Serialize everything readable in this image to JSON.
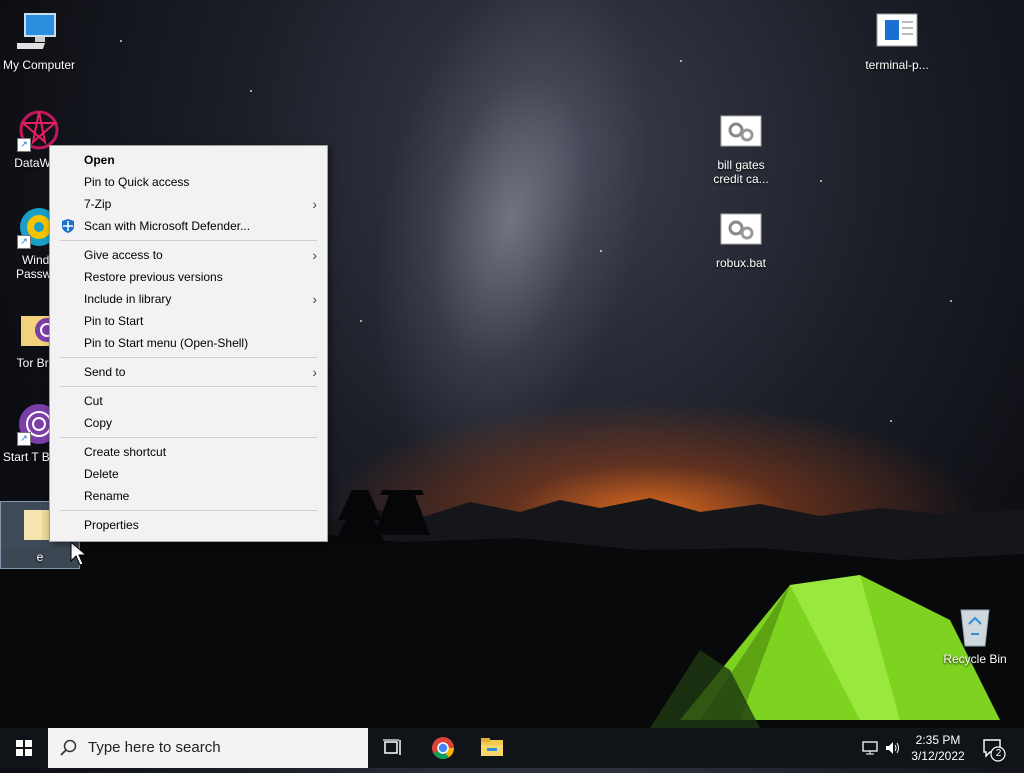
{
  "desktop": {
    "icons": [
      {
        "label": "My Computer"
      },
      {
        "label": "DataWag"
      },
      {
        "label": "Windo Passwor"
      },
      {
        "label": "Tor Brov"
      },
      {
        "label": "Start T Brows"
      },
      {
        "label": "e"
      },
      {
        "label": "terminal-p..."
      },
      {
        "label": "bill gates credit ca..."
      },
      {
        "label": "robux.bat"
      },
      {
        "label": "Recycle Bin"
      }
    ]
  },
  "context_menu": {
    "items": [
      {
        "label": "Open"
      },
      {
        "label": "Pin to Quick access"
      },
      {
        "label": "7-Zip"
      },
      {
        "label": "Scan with Microsoft Defender..."
      },
      {
        "label": "Give access to"
      },
      {
        "label": "Restore previous versions"
      },
      {
        "label": "Include in library"
      },
      {
        "label": "Pin to Start"
      },
      {
        "label": "Pin to Start menu (Open-Shell)"
      },
      {
        "label": "Send to"
      },
      {
        "label": "Cut"
      },
      {
        "label": "Copy"
      },
      {
        "label": "Create shortcut"
      },
      {
        "label": "Delete"
      },
      {
        "label": "Rename"
      },
      {
        "label": "Properties"
      }
    ]
  },
  "taskbar": {
    "search_placeholder": "Type here to search",
    "time": "2:35 PM",
    "date": "3/12/2022",
    "notification_count": "2"
  },
  "colors": {
    "accent": "#1b6fd0",
    "taskbar_bg": "#101318",
    "menu_bg": "#f2f2f2",
    "tent_green": "#7ed321"
  }
}
